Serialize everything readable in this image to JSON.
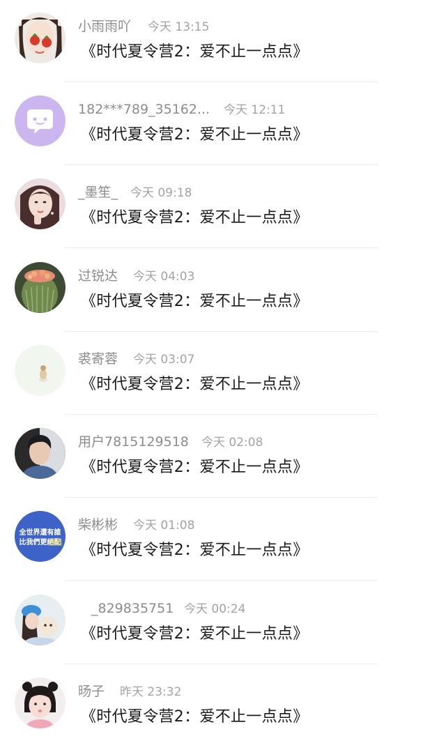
{
  "comments": [
    {
      "name": "小雨雨吖",
      "time": "今天 13:15",
      "content": "《时代夏令营2：爱不止一点点》",
      "avatar_icon": "avatar-girl-strawberries"
    },
    {
      "name": "182***789_35162...",
      "time": "今天 12:11",
      "content": "《时代夏令营2：爱不止一点点》",
      "avatar_icon": "avatar-default-chat-bubble"
    },
    {
      "name": "_墨笙_",
      "time": "今天 09:18",
      "content": "《时代夏令营2：爱不止一点点》",
      "avatar_icon": "avatar-girl-portrait"
    },
    {
      "name": "过锐达",
      "time": "今天 04:03",
      "content": "《时代夏令营2：爱不止一点点》",
      "avatar_icon": "avatar-cactus"
    },
    {
      "name": "裘寄蓉",
      "time": "今天 03:07",
      "content": "《时代夏令营2：爱不止一点点》",
      "avatar_icon": "avatar-small-figure"
    },
    {
      "name": "用户7815129518",
      "time": "今天 02:08",
      "content": "《时代夏令营2：爱不止一点点》",
      "avatar_icon": "avatar-boy-portrait"
    },
    {
      "name": "柴彬彬",
      "time": "今天 01:08",
      "content": "《时代夏令营2：爱不止一点点》",
      "avatar_icon": "avatar-text-logo",
      "avatar_text": [
        "全世界還有誰",
        "比我們更絕配"
      ]
    },
    {
      "name": "_829835751",
      "time": "今天 00:24",
      "content": "《时代夏令营2：爱不止一点点》",
      "avatar_icon": "avatar-girl-blue-hat"
    },
    {
      "name": "旸子",
      "time": "昨天 23:32",
      "content": "《时代夏令营2：爱不止一点点》",
      "avatar_icon": "avatar-girl-buns"
    }
  ]
}
